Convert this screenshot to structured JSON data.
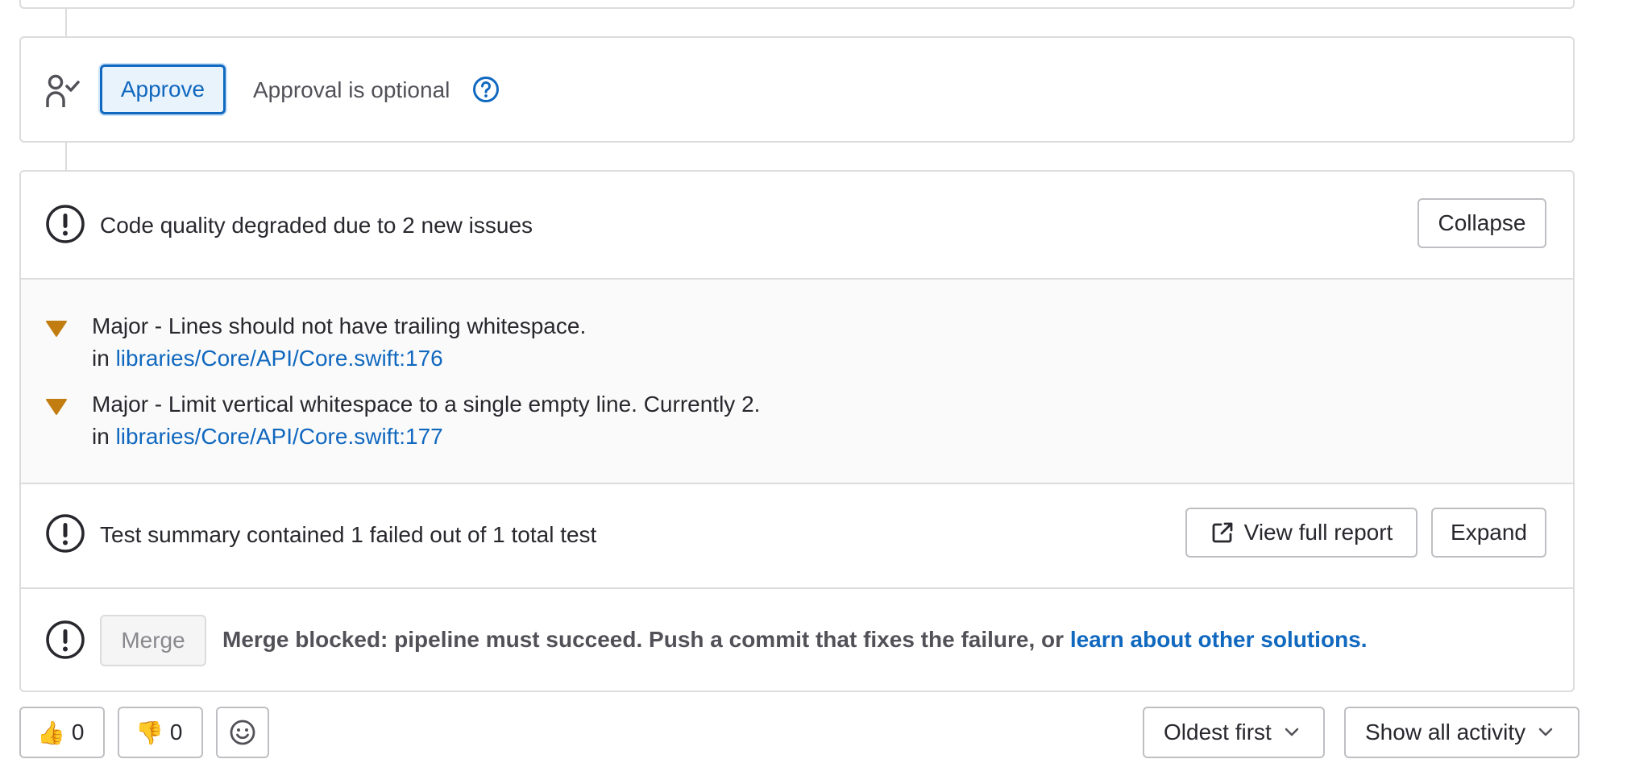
{
  "approval": {
    "approve_label": "Approve",
    "optional_text": "Approval is optional",
    "icons": {
      "approval": "approval-check-icon",
      "help": "question-circle-icon"
    }
  },
  "code_quality": {
    "title": "Code quality degraded due to 2 new issues",
    "collapse_label": "Collapse",
    "issues": [
      {
        "severity_icon": "triangle-down-warning-icon",
        "description": "Major - Lines should not have trailing whitespace.",
        "in_prefix": "in",
        "location": "libraries/Core/API/Core.swift:176"
      },
      {
        "severity_icon": "triangle-down-warning-icon",
        "description": "Major - Limit vertical whitespace to a single empty line. Currently 2.",
        "in_prefix": "in",
        "location": "libraries/Core/API/Core.swift:177"
      }
    ]
  },
  "tests": {
    "title": "Test summary contained 1 failed out of 1 total test",
    "view_report_label": "View full report",
    "expand_label": "Expand"
  },
  "merge": {
    "merge_label": "Merge",
    "blocked_text": "Merge blocked: pipeline must succeed. Push a commit that fixes the failure, or ",
    "learn_link": "learn about other solutions."
  },
  "reactions": {
    "thumbs_up_emoji": "👍",
    "thumbs_up_count": "0",
    "thumbs_down_emoji": "👎",
    "thumbs_down_count": "0"
  },
  "sort": {
    "selected": "Oldest first"
  },
  "filter": {
    "selected": "Show all activity"
  },
  "colors": {
    "link": "#1068bf",
    "warning": "#c17d10",
    "border": "#dcdcde"
  }
}
